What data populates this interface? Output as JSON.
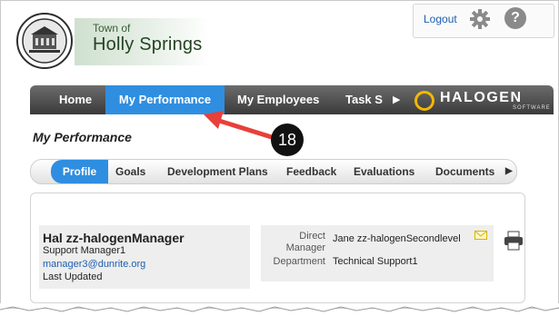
{
  "header": {
    "town_small": "Town of",
    "town_big": "Holly Springs",
    "logout": "Logout",
    "icons": [
      "gear-icon",
      "help-icon"
    ],
    "help_glyph": "?"
  },
  "nav": {
    "items": [
      "Home",
      "My Performance",
      "My Employees",
      "Task S"
    ],
    "more_glyph": "▶",
    "brand": "HALOGEN",
    "brand_sub": "SOFTWARE"
  },
  "annotation": {
    "badge": "18"
  },
  "page": {
    "title": "My Performance"
  },
  "subnav": {
    "items": [
      "Profile",
      "Goals",
      "Development Plans",
      "Feedback",
      "Evaluations",
      "Documents"
    ],
    "more_glyph": "▶"
  },
  "profile": {
    "name": "Hal zz-halogenManager",
    "role": "Support Manager1",
    "email": "manager3@dunrite.org",
    "updated_label": "Last Updated",
    "direct_manager_label_1": "Direct",
    "direct_manager_label_2": "Manager",
    "direct_manager_value": "Jane zz-halogenSecondlevel",
    "department_label": "Department",
    "department_value": "Technical Support1"
  },
  "colors": {
    "accent": "#2f8ee0",
    "nav_bg": "#4a4a4a",
    "callout": "#e8403a",
    "link": "#1d5fb0"
  }
}
